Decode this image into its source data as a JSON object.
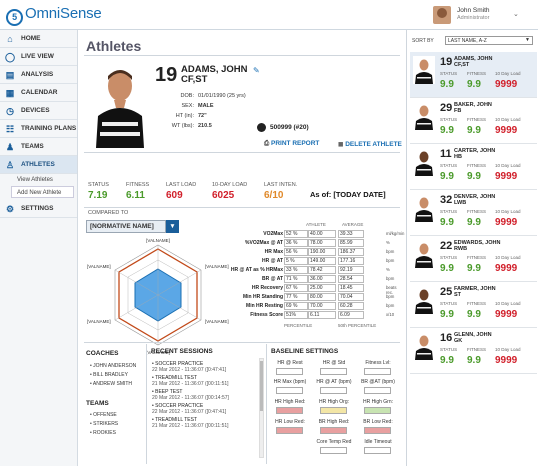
{
  "app": {
    "brand_num": "5",
    "brand_name": "OmniSense"
  },
  "user": {
    "name": "John Smith",
    "role": "Administrator"
  },
  "sidebar": {
    "items": [
      {
        "label": "HOME",
        "icon": "home-icon"
      },
      {
        "label": "LIVE VIEW",
        "icon": "live-view-icon"
      },
      {
        "label": "ANALYSIS",
        "icon": "analysis-icon"
      },
      {
        "label": "CALENDAR",
        "icon": "calendar-icon"
      },
      {
        "label": "DEVICES",
        "icon": "devices-icon"
      },
      {
        "label": "TRAINING PLANS",
        "icon": "training-plans-icon"
      },
      {
        "label": "TEAMS",
        "icon": "teams-icon"
      },
      {
        "label": "ATHLETES",
        "icon": "athletes-icon"
      }
    ],
    "sub": [
      "View Athletes",
      "Add New Athlete"
    ],
    "settings": "SETTINGS"
  },
  "page": {
    "title": "Athletes"
  },
  "athlete": {
    "number": "19",
    "name_line1": "ADAMS, JOHN",
    "name_line2": "CF,ST",
    "dob_label": "DOB:",
    "dob": "01/01/1990 (25 yrs)",
    "sex_label": "SEX:",
    "sex": "MALE",
    "ht_label": "HT (in):",
    "ht": "72\"",
    "wt_label": "WT (lbs):",
    "wt": "210.5",
    "device_id": "500999 (#20)"
  },
  "actions": {
    "print": "PRINT REPORT",
    "delete": "DELETE ATHLETE"
  },
  "stats": [
    {
      "label": "STATUS",
      "value": "7.19",
      "color": "#4a9a2a"
    },
    {
      "label": "FITNESS",
      "value": "6.11",
      "color": "#4a9a2a"
    },
    {
      "label": "LAST LOAD",
      "value": "609",
      "color": "#d11f2a"
    },
    {
      "label": "10-DAY LOAD",
      "value": "6025",
      "color": "#d11f2a"
    },
    {
      "label": "LAST INTEN.",
      "value": "6/10",
      "color": "#e0892a"
    }
  ],
  "as_of": "As of: [TODAY DATE]",
  "compare": {
    "label": "COMPARED TO",
    "value": "[NORMATIVE NAME]"
  },
  "radar": {
    "labels": [
      "[VALNAME]",
      "[VALNAME]",
      "[VALNAME]",
      "[VALNAME]",
      "[VALNAME]",
      "[VALNAME]"
    ]
  },
  "table": {
    "header_athlete": "ATHLETE",
    "header_average": "AVERAGE",
    "rows": [
      {
        "label": "VO2Max",
        "pct": "52 %",
        "ath": "40.00",
        "avg": "39.33",
        "unit": "ml/kg/min"
      },
      {
        "label": "%VO2Max @ AT",
        "pct": "36 %",
        "ath": "78.00",
        "avg": "85.99",
        "unit": "%"
      },
      {
        "label": "HR Max",
        "pct": "56 %",
        "ath": "190.00",
        "avg": "186.37",
        "unit": "bpm"
      },
      {
        "label": "HR @ AT",
        "pct": "5 %",
        "ath": "149.00",
        "avg": "177.16",
        "unit": "bpm"
      },
      {
        "label": "HR @ AT as % HRMax",
        "pct": "33 %",
        "ath": "78.42",
        "avg": "92.19",
        "unit": "%"
      },
      {
        "label": "BR @ AT",
        "pct": "71 %",
        "ath": "36.00",
        "avg": "28.54",
        "unit": "bpm"
      },
      {
        "label": "HR Recovery",
        "pct": "67 %",
        "ath": "25.00",
        "avg": "18.45",
        "unit": "beats rec."
      },
      {
        "label": "Min HR Standing",
        "pct": "77 %",
        "ath": "80.00",
        "avg": "70.04",
        "unit": "bpm"
      },
      {
        "label": "Min HR Resting",
        "pct": "69 %",
        "ath": "70.00",
        "avg": "60.28",
        "unit": "bpm"
      },
      {
        "label": "Fitness Score",
        "pct": "51%",
        "ath": "6.11",
        "avg": "6.09",
        "unit": "x/10"
      }
    ],
    "foot_left": "PERCENTILE",
    "foot_right": "50th PERCENTILE"
  },
  "coaches": {
    "title": "COACHES",
    "items": [
      "JOHN ANDERSON",
      "BILL BRADLEY",
      "ANDREW SMITH"
    ]
  },
  "teams": {
    "title": "TEAMS",
    "items": [
      "OFFENSE",
      "STRIKERS",
      "ROOKIES"
    ]
  },
  "sessions": {
    "title": "RECENT SESSIONS",
    "items": [
      {
        "name": "SOCCER PRACTICE",
        "date": "22 Mar 2012 - 11:36:07 ([0:47:41]"
      },
      {
        "name": "TREADMILL TEST",
        "date": "21 Mar 2012 - 11:36:07 ([00:11:51]"
      },
      {
        "name": "BEEP TEST",
        "date": "20 Mar 2012 - 11:36:07 ([00:14:57]"
      },
      {
        "name": "SOCCER PRACTICE",
        "date": "22 Mar 2012 - 11:36:07 ([0:47:41]"
      },
      {
        "name": "TREADMILL TEST",
        "date": "21 Mar 2012 - 11:36:07 ([00:11:51]"
      }
    ]
  },
  "baseline": {
    "title": "BASELINE SETTINGS",
    "fields": [
      "HR @ Rest",
      "HR @ Std",
      "Fitness Lvl:",
      "HR Max (bpm)",
      "HR @ AT (bpm)",
      "BR @AT (bpm)",
      "HR High Red:",
      "HR High Org:",
      "HR High Grn:",
      "HR Low Red:",
      "BR High Red:",
      "BR Low Red:",
      "Core Temp Red",
      "Idle Timeout"
    ]
  },
  "roster": {
    "sort_label": "SORT BY",
    "sort_value": "LAST NAME, A-Z",
    "col_status": "STATUS",
    "col_fitness": "FITNESS",
    "col_load": "10 Day Load",
    "athletes": [
      {
        "num": "19",
        "name": "ADAMS, JOHN",
        "pos": "CF,ST",
        "status": "9.9",
        "fitness": "9.9",
        "load": "9999"
      },
      {
        "num": "29",
        "name": "BAKER, JOHN",
        "pos": "FB",
        "status": "9.9",
        "fitness": "9.9",
        "load": "9999"
      },
      {
        "num": "11",
        "name": "CARTER, JOHN",
        "pos": "HB",
        "status": "9.9",
        "fitness": "9.9",
        "load": "9999"
      },
      {
        "num": "32",
        "name": "DENVER, JOHN",
        "pos": "LWB",
        "status": "9.9",
        "fitness": "9.9",
        "load": "9999"
      },
      {
        "num": "22",
        "name": "EDWARDS, JOHN",
        "pos": "RWB",
        "status": "9.9",
        "fitness": "9.9",
        "load": "9999"
      },
      {
        "num": "25",
        "name": "FARMER, JOHN",
        "pos": "ST",
        "status": "9.9",
        "fitness": "9.9",
        "load": "9999"
      },
      {
        "num": "16",
        "name": "GLENN, JOHN",
        "pos": "GK",
        "status": "9.9",
        "fitness": "9.9",
        "load": "9999"
      }
    ]
  }
}
